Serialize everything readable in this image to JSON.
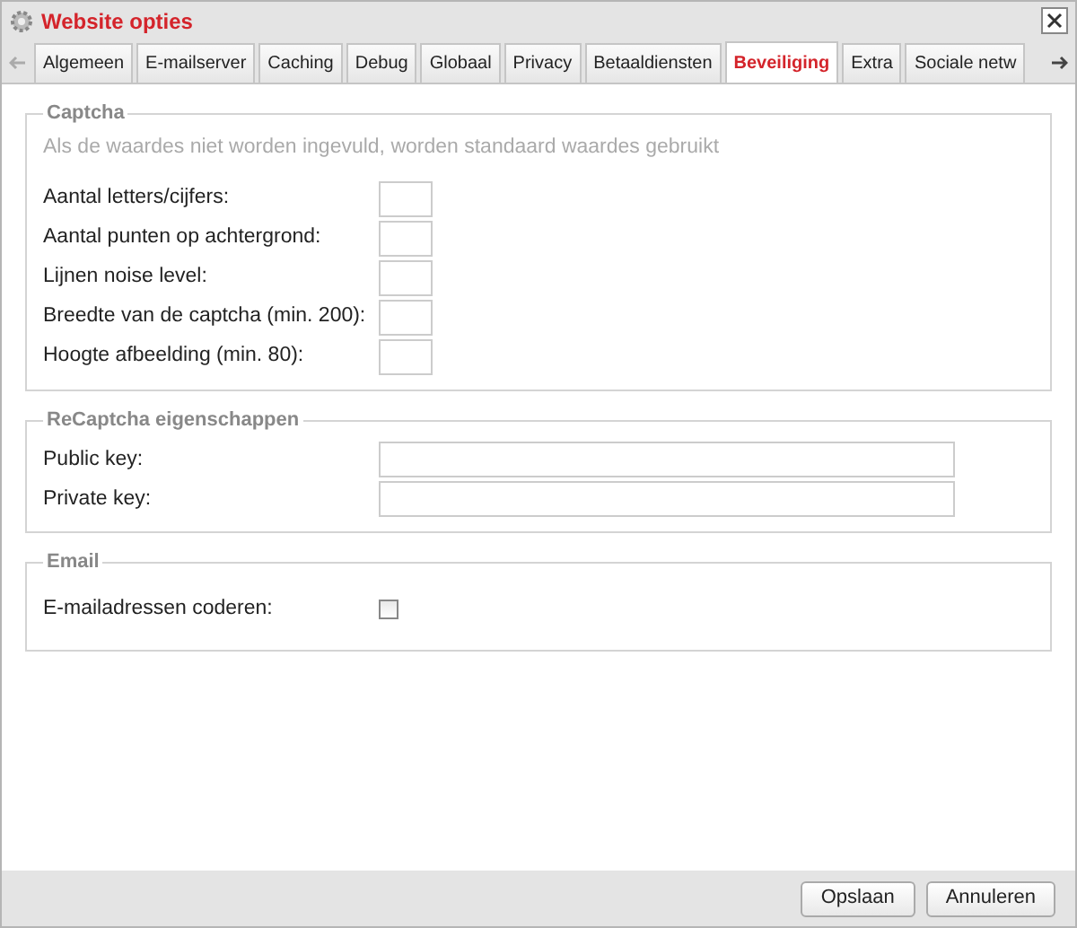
{
  "window": {
    "title": "Website opties"
  },
  "tabs": [
    {
      "label": "Algemeen",
      "selected": false
    },
    {
      "label": "E-mailserver",
      "selected": false
    },
    {
      "label": "Caching",
      "selected": false
    },
    {
      "label": "Debug",
      "selected": false
    },
    {
      "label": "Globaal",
      "selected": false
    },
    {
      "label": "Privacy",
      "selected": false
    },
    {
      "label": "Betaaldiensten",
      "selected": false
    },
    {
      "label": "Beveiliging",
      "selected": true
    },
    {
      "label": "Extra",
      "selected": false
    },
    {
      "label": "Sociale netw",
      "selected": false
    }
  ],
  "sections": [
    {
      "legend": "Captcha",
      "note": "Als de waardes niet worden ingevuld, worden standaard waardes gebruikt",
      "fields": [
        {
          "kind": "short",
          "label": "Aantal letters/cijfers:"
        },
        {
          "kind": "short",
          "label": "Aantal punten op achtergrond:"
        },
        {
          "kind": "short",
          "label": "Lijnen noise level:"
        },
        {
          "kind": "short",
          "label": "Breedte van de captcha (min. 200):"
        },
        {
          "kind": "short",
          "label": "Hoogte afbeelding (min. 80):"
        }
      ]
    },
    {
      "legend": "ReCaptcha eigenschappen",
      "fields": [
        {
          "kind": "wide",
          "label": "Public key:"
        },
        {
          "kind": "wide",
          "label": "Private key:"
        }
      ]
    },
    {
      "legend": "Email",
      "fields": [
        {
          "kind": "checkbox",
          "label": "E-mailadressen coderen:",
          "checked": false
        }
      ]
    }
  ],
  "buttons": [
    "Opslaan",
    "Annuleren"
  ]
}
